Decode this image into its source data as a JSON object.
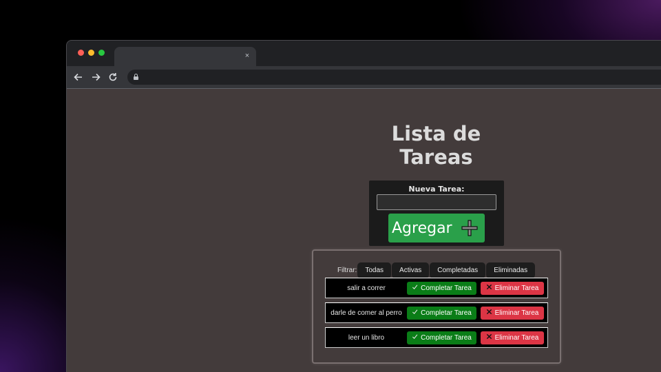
{
  "browser": {
    "tab_title": "",
    "tab_close": "×",
    "address": "",
    "window_dots": [
      "#ff5f57",
      "#febc2e",
      "#28c840"
    ],
    "nav_icons": [
      "back-arrow-icon",
      "forward-arrow-icon",
      "reload-icon"
    ]
  },
  "page": {
    "title": "Lista de Tareas",
    "form": {
      "label": "Nueva Tarea:",
      "input_value": "",
      "input_placeholder": "",
      "add_label": "Agregar"
    },
    "filter": {
      "label": "Filtrar:",
      "options": [
        "Todas",
        "Activas",
        "Completadas",
        "Eliminadas"
      ]
    },
    "tasks": [
      {
        "text": "salir a correr",
        "complete_label": "Completar Tarea",
        "delete_label": "Eliminar Tarea"
      },
      {
        "text": "darle de comer al perro",
        "complete_label": "Completar Tarea",
        "delete_label": "Eliminar Tarea"
      },
      {
        "text": "leer un libro",
        "complete_label": "Completar Tarea",
        "delete_label": "Eliminar Tarea"
      }
    ]
  },
  "colors": {
    "page_bg": "#433b3b",
    "add_button": "#2aa04a",
    "complete_button": "#0a7d17",
    "delete_button": "#dc3545"
  }
}
